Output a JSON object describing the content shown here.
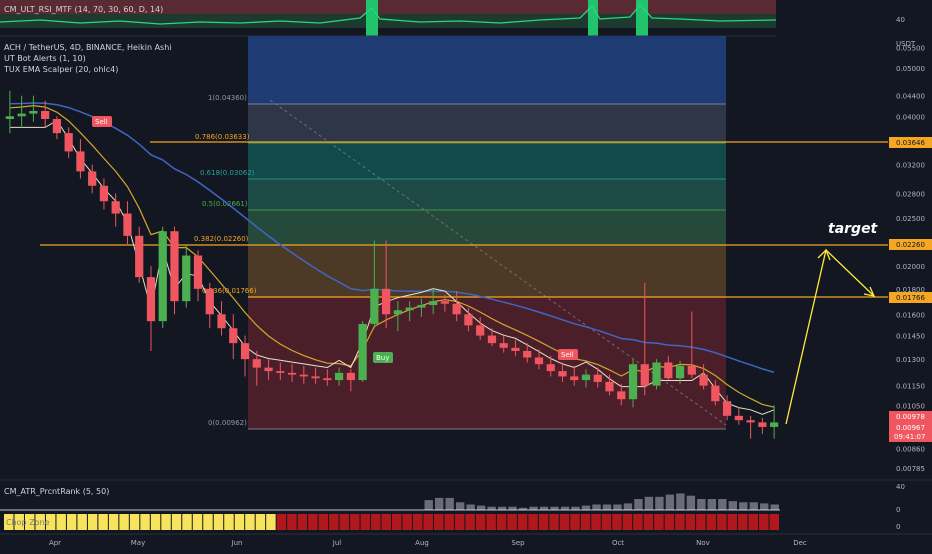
{
  "top_indicator": {
    "label": "CM_ULT_RSI_MTF (14, 70, 30, 60, D, 14)",
    "axis_value": "40"
  },
  "main_legend": {
    "symbol": "ACH / TetherUS, 4D, BINANCE, Heikin Ashi",
    "ind1": "UT Bot Alerts (1, 10)",
    "ind2": "TUX EMA Scalper (20, ohlc4)"
  },
  "price_axis": {
    "unit": "USDT",
    "ticks": [
      "0.05500",
      "0.05000",
      "0.04400",
      "0.04000",
      "0.03600",
      "0.03200",
      "0.02800",
      "0.02500",
      "0.02200",
      "0.02000",
      "0.01800",
      "0.01600",
      "0.01450",
      "0.01300",
      "0.01150",
      "0.01050",
      "0.00860",
      "0.00785"
    ],
    "highlight_labels": {
      "level_1": "0.03646",
      "level_2": "0.02260",
      "level_3": "0.01766",
      "last_1": "0.00978",
      "last_2": "0.00967",
      "countdown": "09:41:07"
    }
  },
  "fib_labels": [
    "1(0.04360)",
    "0.786(0.03633)",
    "0.618(0.03062)",
    "0.5(0.02661)",
    "0.382(0.02260)",
    "0.236(0.01766)",
    "0(0.00962)"
  ],
  "annotations": {
    "target": "target",
    "sell_label": "Sell",
    "buy_label": "Buy"
  },
  "bottom_indicator": {
    "label": "CM_ATR_PrcntRank (5, 50)",
    "axis_ticks": [
      "40",
      "0"
    ],
    "sub_label": "Chop Zone",
    "sub_axis": "0"
  },
  "time_axis": {
    "labels": [
      "Apr",
      "May",
      "Jun",
      "Jul",
      "Aug",
      "Sep",
      "Oct",
      "Nov",
      "Dec"
    ]
  },
  "colors": {
    "up": "#26a69a",
    "up_bright": "#4caf50",
    "down": "#f0565f",
    "orange": "#f5a623",
    "background": "#131722"
  },
  "chart_data": {
    "type": "candlestick",
    "title": "ACH / TetherUS, 4D, BINANCE, Heikin Ashi",
    "ylabel": "USDT",
    "ylim": [
      0.0075,
      0.058
    ],
    "y_scale": "log",
    "candles": [
      {
        "o": 0.0395,
        "h": 0.045,
        "l": 0.037,
        "c": 0.04
      },
      {
        "o": 0.04,
        "h": 0.044,
        "l": 0.038,
        "c": 0.0405
      },
      {
        "o": 0.0405,
        "h": 0.044,
        "l": 0.039,
        "c": 0.041
      },
      {
        "o": 0.041,
        "h": 0.043,
        "l": 0.038,
        "c": 0.0395
      },
      {
        "o": 0.0395,
        "h": 0.04,
        "l": 0.036,
        "c": 0.037
      },
      {
        "o": 0.037,
        "h": 0.038,
        "l": 0.033,
        "c": 0.034
      },
      {
        "o": 0.034,
        "h": 0.036,
        "l": 0.03,
        "c": 0.031
      },
      {
        "o": 0.031,
        "h": 0.032,
        "l": 0.028,
        "c": 0.029
      },
      {
        "o": 0.029,
        "h": 0.03,
        "l": 0.026,
        "c": 0.027
      },
      {
        "o": 0.027,
        "h": 0.028,
        "l": 0.024,
        "c": 0.0255
      },
      {
        "o": 0.0255,
        "h": 0.027,
        "l": 0.022,
        "c": 0.023
      },
      {
        "o": 0.023,
        "h": 0.024,
        "l": 0.0185,
        "c": 0.019
      },
      {
        "o": 0.019,
        "h": 0.02,
        "l": 0.0135,
        "c": 0.0155
      },
      {
        "o": 0.0155,
        "h": 0.024,
        "l": 0.015,
        "c": 0.0235
      },
      {
        "o": 0.0235,
        "h": 0.024,
        "l": 0.016,
        "c": 0.017
      },
      {
        "o": 0.017,
        "h": 0.022,
        "l": 0.0165,
        "c": 0.021
      },
      {
        "o": 0.021,
        "h": 0.0215,
        "l": 0.017,
        "c": 0.018
      },
      {
        "o": 0.018,
        "h": 0.0185,
        "l": 0.015,
        "c": 0.016
      },
      {
        "o": 0.016,
        "h": 0.017,
        "l": 0.0145,
        "c": 0.015
      },
      {
        "o": 0.015,
        "h": 0.016,
        "l": 0.013,
        "c": 0.014
      },
      {
        "o": 0.014,
        "h": 0.0145,
        "l": 0.012,
        "c": 0.013
      },
      {
        "o": 0.013,
        "h": 0.0135,
        "l": 0.0115,
        "c": 0.0125
      },
      {
        "o": 0.0125,
        "h": 0.013,
        "l": 0.0118,
        "c": 0.0123
      },
      {
        "o": 0.0123,
        "h": 0.0128,
        "l": 0.0118,
        "c": 0.0122
      },
      {
        "o": 0.0122,
        "h": 0.0127,
        "l": 0.0117,
        "c": 0.0121
      },
      {
        "o": 0.0121,
        "h": 0.0126,
        "l": 0.0116,
        "c": 0.012
      },
      {
        "o": 0.012,
        "h": 0.0125,
        "l": 0.0116,
        "c": 0.0119
      },
      {
        "o": 0.0119,
        "h": 0.0124,
        "l": 0.0115,
        "c": 0.0118
      },
      {
        "o": 0.0118,
        "h": 0.0125,
        "l": 0.0115,
        "c": 0.0122
      },
      {
        "o": 0.0122,
        "h": 0.0124,
        "l": 0.0112,
        "c": 0.0118
      },
      {
        "o": 0.0118,
        "h": 0.0155,
        "l": 0.0117,
        "c": 0.0153
      },
      {
        "o": 0.0153,
        "h": 0.0225,
        "l": 0.015,
        "c": 0.018
      },
      {
        "o": 0.018,
        "h": 0.0225,
        "l": 0.015,
        "c": 0.016
      },
      {
        "o": 0.016,
        "h": 0.017,
        "l": 0.0148,
        "c": 0.0163
      },
      {
        "o": 0.0163,
        "h": 0.017,
        "l": 0.0155,
        "c": 0.0165
      },
      {
        "o": 0.0165,
        "h": 0.0172,
        "l": 0.0158,
        "c": 0.0167
      },
      {
        "o": 0.0167,
        "h": 0.018,
        "l": 0.016,
        "c": 0.017
      },
      {
        "o": 0.017,
        "h": 0.0175,
        "l": 0.0162,
        "c": 0.0168
      },
      {
        "o": 0.0168,
        "h": 0.0178,
        "l": 0.0155,
        "c": 0.016
      },
      {
        "o": 0.016,
        "h": 0.0165,
        "l": 0.0148,
        "c": 0.0152
      },
      {
        "o": 0.0152,
        "h": 0.0158,
        "l": 0.0142,
        "c": 0.0145
      },
      {
        "o": 0.0145,
        "h": 0.015,
        "l": 0.0138,
        "c": 0.014
      },
      {
        "o": 0.014,
        "h": 0.0145,
        "l": 0.0134,
        "c": 0.0137
      },
      {
        "o": 0.0137,
        "h": 0.0142,
        "l": 0.0132,
        "c": 0.0135
      },
      {
        "o": 0.0135,
        "h": 0.014,
        "l": 0.0128,
        "c": 0.0131
      },
      {
        "o": 0.0131,
        "h": 0.0136,
        "l": 0.0124,
        "c": 0.0127
      },
      {
        "o": 0.0127,
        "h": 0.0132,
        "l": 0.012,
        "c": 0.0123
      },
      {
        "o": 0.0123,
        "h": 0.0128,
        "l": 0.0117,
        "c": 0.012
      },
      {
        "o": 0.012,
        "h": 0.0126,
        "l": 0.0115,
        "c": 0.0118
      },
      {
        "o": 0.0118,
        "h": 0.0124,
        "l": 0.0114,
        "c": 0.0121
      },
      {
        "o": 0.0121,
        "h": 0.0125,
        "l": 0.0114,
        "c": 0.0117
      },
      {
        "o": 0.0117,
        "h": 0.0121,
        "l": 0.011,
        "c": 0.0112
      },
      {
        "o": 0.0112,
        "h": 0.0116,
        "l": 0.0105,
        "c": 0.0108
      },
      {
        "o": 0.0108,
        "h": 0.013,
        "l": 0.0104,
        "c": 0.0127
      },
      {
        "o": 0.0127,
        "h": 0.0185,
        "l": 0.011,
        "c": 0.0115
      },
      {
        "o": 0.0115,
        "h": 0.013,
        "l": 0.0113,
        "c": 0.0128
      },
      {
        "o": 0.0128,
        "h": 0.0132,
        "l": 0.0118,
        "c": 0.0119
      },
      {
        "o": 0.0119,
        "h": 0.0129,
        "l": 0.0116,
        "c": 0.0126
      },
      {
        "o": 0.0126,
        "h": 0.0162,
        "l": 0.0119,
        "c": 0.0121
      },
      {
        "o": 0.0121,
        "h": 0.0127,
        "l": 0.0113,
        "c": 0.0115
      },
      {
        "o": 0.0115,
        "h": 0.0118,
        "l": 0.0105,
        "c": 0.0107
      },
      {
        "o": 0.0107,
        "h": 0.011,
        "l": 0.0098,
        "c": 0.01
      },
      {
        "o": 0.01,
        "h": 0.0104,
        "l": 0.0096,
        "c": 0.0098
      },
      {
        "o": 0.0098,
        "h": 0.01,
        "l": 0.009,
        "c": 0.0097
      },
      {
        "o": 0.0097,
        "h": 0.0099,
        "l": 0.0092,
        "c": 0.0095
      },
      {
        "o": 0.0095,
        "h": 0.0105,
        "l": 0.009,
        "c": 0.0097
      }
    ],
    "horizontal_levels": [
      0.03646,
      0.0226,
      0.01766
    ],
    "fib_levels": [
      0.0436,
      0.03633,
      0.03062,
      0.02661,
      0.0226,
      0.01766,
      0.00962
    ],
    "atr_rank": [
      0,
      0,
      0,
      0,
      0,
      0,
      0,
      0,
      0,
      0,
      0,
      0,
      0,
      0,
      0,
      0,
      0,
      0,
      0,
      0,
      0,
      0,
      0,
      0,
      0,
      0,
      0,
      0,
      0,
      0,
      0,
      0,
      0,
      0,
      0,
      0,
      0,
      0,
      0,
      0,
      18,
      22,
      22,
      14,
      10,
      8,
      6,
      6,
      6,
      4,
      6,
      6,
      6,
      6,
      6,
      8,
      10,
      10,
      10,
      12,
      20,
      24,
      24,
      28,
      30,
      26,
      20,
      20,
      20,
      16,
      14,
      14,
      12,
      10
    ]
  }
}
